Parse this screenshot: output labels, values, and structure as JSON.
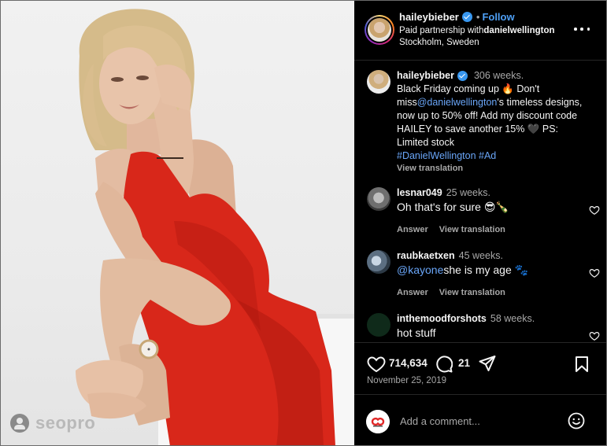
{
  "photo": {
    "watermark_text": "seopro"
  },
  "header": {
    "username": "haileybieber",
    "separator": "•",
    "follow_label": "Follow",
    "partnership_prefix": "Paid partnership with",
    "partner": "danielwellington",
    "location": "Stockholm, Sweden"
  },
  "caption": {
    "username": "haileybieber",
    "time": "306 weeks.",
    "text_1": "Black Friday coming up 🔥 Don't miss",
    "mention": "@danielwellington",
    "text_2": "'s timeless designs, now up to 50% off! Add my discount code HAILEY to save another 15% 🖤 PS: Limited stock",
    "hashtag_1": "#DanielWellington",
    "hashtag_2": "#Ad",
    "view_translation": "View translation"
  },
  "comments": [
    {
      "username": "lesnar049",
      "time": "25 weeks.",
      "text": "Oh that's for sure 😎🍾",
      "answer_label": "Answer",
      "translation_label": "View translation"
    },
    {
      "username": "raubkaetxen",
      "time": "45 weeks.",
      "mention": "@kayone",
      "text": "she is my age 🐾",
      "answer_label": "Answer",
      "translation_label": "View translation"
    },
    {
      "username": "inthemoodforshots",
      "time": "58 weeks.",
      "text": "hot stuff"
    }
  ],
  "actions": {
    "likes": "714,634",
    "comments": "21",
    "date": "November 25, 2019"
  },
  "add_comment": {
    "placeholder": "Add a comment..."
  },
  "colors": {
    "background": "#000000",
    "link": "#4e9ff5",
    "mention": "#6aa6f8",
    "dress": "#d8271a",
    "muted_text": "#a8a8a8"
  }
}
